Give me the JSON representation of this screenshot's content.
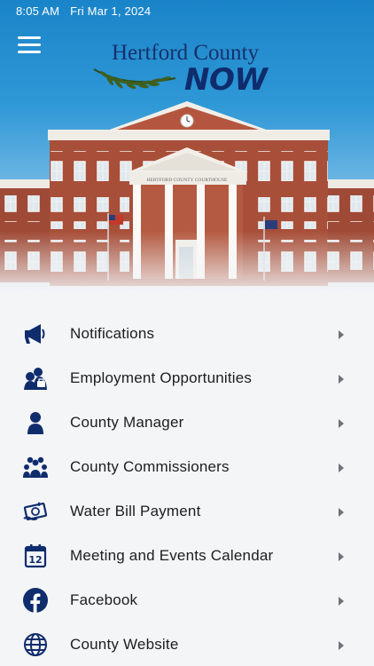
{
  "status_bar": {
    "time": "8:05 AM",
    "date": "Fri Mar 1, 2024"
  },
  "header": {
    "logo_line1": "Hertford County",
    "logo_line2": "NOW",
    "courthouse_sign": "HERTFORD COUNTY COURTHOUSE"
  },
  "colors": {
    "accent": "#0f2c6c",
    "chevron": "#6f7278",
    "background": "#f4f5f7"
  },
  "menu": {
    "items": [
      {
        "label": "Notifications",
        "icon": "megaphone-icon"
      },
      {
        "label": "Employment Opportunities",
        "icon": "employment-icon"
      },
      {
        "label": "County Manager",
        "icon": "person-icon"
      },
      {
        "label": "County Commissioners",
        "icon": "group-icon"
      },
      {
        "label": "Water Bill Payment",
        "icon": "water-bill-icon"
      },
      {
        "label": "Meeting and Events Calendar",
        "icon": "calendar-icon"
      },
      {
        "label": "Facebook",
        "icon": "facebook-icon"
      },
      {
        "label": "County Website",
        "icon": "globe-icon"
      }
    ]
  }
}
